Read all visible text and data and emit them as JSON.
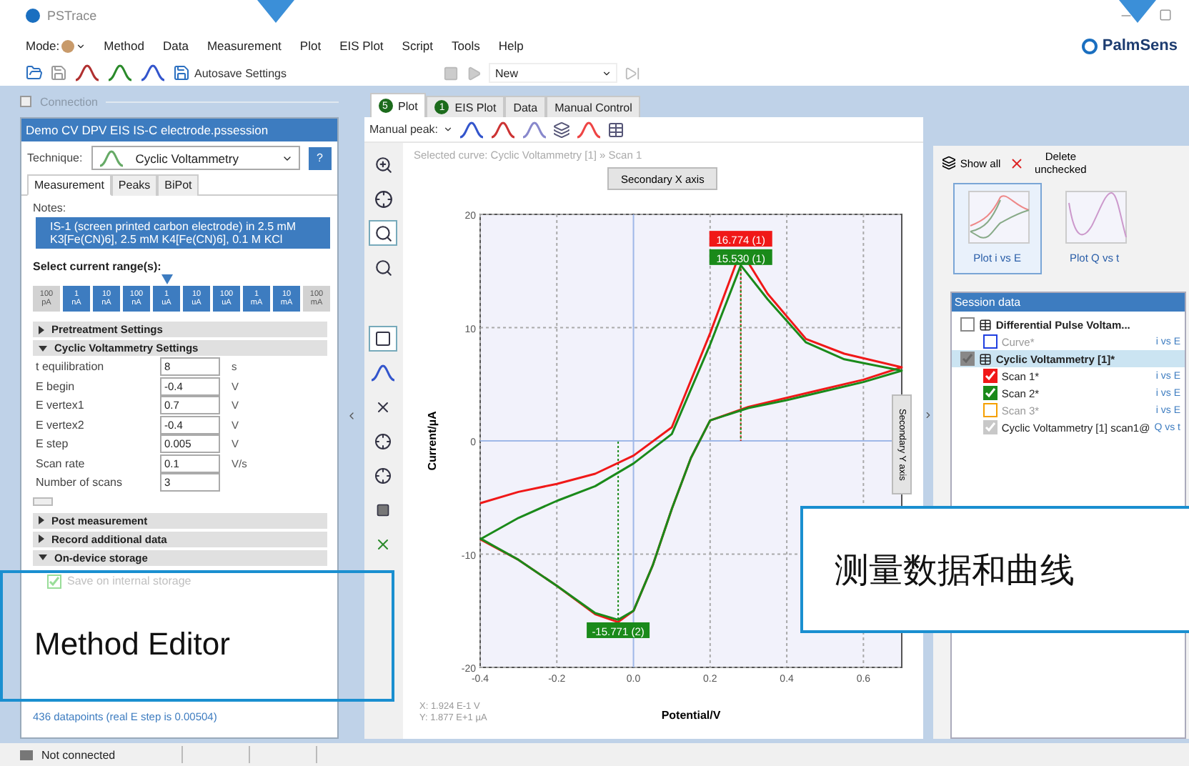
{
  "window": {
    "title": "PSTrace"
  },
  "menu": {
    "mode_label": "Mode:",
    "items": [
      "Method",
      "Data",
      "Measurement",
      "Plot",
      "EIS Plot",
      "Script",
      "Tools",
      "Help"
    ]
  },
  "brand": "PalmSens",
  "toolbar": {
    "autosave": "Autosave Settings",
    "script": "New"
  },
  "connection": {
    "title": "Connection",
    "expanded": false
  },
  "method_editor": {
    "file": "Demo CV DPV EIS IS-C electrode.pssession",
    "technique_label": "Technique:",
    "technique": "Cyclic Voltammetry",
    "help": "?",
    "tabs": [
      {
        "label": "Measurement",
        "selected": true
      },
      {
        "label": "Peaks",
        "selected": false
      },
      {
        "label": "BiPot",
        "selected": false
      }
    ],
    "notes_label": "Notes:",
    "notes": "IS-1 (screen printed carbon electrode) in 2.5 mM K3[Fe(CN)6], 2.5 mM K4[Fe(CN)6], 0.1 M KCl",
    "range_label": "Select current range(s):",
    "ranges": [
      {
        "value": "100",
        "unit": "pA",
        "enabled": false,
        "selected": false
      },
      {
        "value": "1",
        "unit": "nA",
        "enabled": true,
        "selected": false
      },
      {
        "value": "10",
        "unit": "nA",
        "enabled": true,
        "selected": false
      },
      {
        "value": "100",
        "unit": "nA",
        "enabled": true,
        "selected": false
      },
      {
        "value": "1",
        "unit": "uA",
        "enabled": true,
        "selected": true
      },
      {
        "value": "10",
        "unit": "uA",
        "enabled": true,
        "selected": false
      },
      {
        "value": "100",
        "unit": "uA",
        "enabled": true,
        "selected": false
      },
      {
        "value": "1",
        "unit": "mA",
        "enabled": true,
        "selected": false
      },
      {
        "value": "10",
        "unit": "mA",
        "enabled": true,
        "selected": false
      },
      {
        "value": "100",
        "unit": "mA",
        "enabled": false,
        "selected": false
      }
    ],
    "sections": [
      {
        "title": "Pretreatment Settings",
        "expanded": false
      },
      {
        "title": "Cyclic Voltammetry Settings",
        "expanded": true,
        "params": [
          {
            "label": "t equilibration",
            "value": "8",
            "unit": "s"
          },
          {
            "label": "E begin",
            "value": "-0.4",
            "unit": "V"
          },
          {
            "label": "E vertex1",
            "value": "0.7",
            "unit": "V"
          },
          {
            "label": "E vertex2",
            "value": "-0.4",
            "unit": "V"
          },
          {
            "label": "E step",
            "value": "0.005",
            "unit": "V"
          },
          {
            "label": "Scan rate",
            "value": "0.1",
            "unit": "V/s"
          },
          {
            "label": "Number of scans",
            "value": "3"
          }
        ]
      },
      {
        "title": "Post measurement",
        "expanded": false
      },
      {
        "title": "Record additional data",
        "expanded": false
      },
      {
        "title": "On-device storage",
        "expanded": true,
        "options": [
          {
            "label": "Save on internal storage",
            "checked": true,
            "disabled": true
          }
        ]
      }
    ],
    "datapoints": "436 datapoints (real E step is 0.00504)"
  },
  "plot_tabs": [
    {
      "label": "Plot",
      "badge": "5",
      "selected": true
    },
    {
      "label": "EIS Plot",
      "badge": "1",
      "selected": false
    },
    {
      "label": "Data",
      "selected": false
    },
    {
      "label": "Manual Control",
      "selected": false
    }
  ],
  "plot_toolbar": {
    "manual_peak": "Manual peak:"
  },
  "plot": {
    "selected_curve": "Selected curve: Cyclic Voltammetry [1] » Scan 1",
    "secondary_x": "Secondary X axis",
    "secondary_y": "Secondary Y axis",
    "cursor_x": "X: 1.924 E-1 V",
    "cursor_y": "Y: 1.877 E+1 µA",
    "chart_data": {
      "type": "line",
      "xlabel": "Potential/V",
      "ylabel": "Current/µA",
      "xlim": [
        -0.4,
        0.7
      ],
      "ylim": [
        -20,
        20
      ],
      "xticks": [
        -0.4,
        -0.2,
        {
          "value": 0,
          "label": "0.0"
        },
        0.2,
        0.4,
        0.6
      ],
      "yticks": [
        -20,
        -10,
        0,
        10,
        20
      ],
      "grid": true,
      "x": [
        -0.4,
        -0.3,
        -0.2,
        -0.1,
        0,
        0.1,
        0.2,
        0.28,
        0.35,
        0.45,
        0.55,
        0.7,
        0.6,
        0.5,
        0.4,
        0.3,
        0.2,
        0.15,
        0.1,
        0.05,
        0,
        -0.04,
        -0.1,
        -0.2,
        -0.3,
        -0.4
      ],
      "series": [
        {
          "color": "#f01818",
          "values": [
            -5.5,
            -4.5,
            -3.8,
            -2.9,
            -1.3,
            1.2,
            9.5,
            16.8,
            13,
            9,
            7.7,
            6.5,
            5.4,
            4.6,
            3.8,
            3,
            1.8,
            -1.5,
            -6,
            -11,
            -15,
            -16,
            -15.3,
            -12.8,
            -10.5,
            -8.7
          ]
        },
        {
          "color": "#1a8a1a",
          "values": [
            -8.7,
            -6.8,
            -5.3,
            -4,
            -2,
            0.6,
            8.5,
            15.5,
            12.5,
            8.7,
            7.2,
            6.2,
            5.2,
            4.4,
            3.6,
            2.9,
            1.8,
            -1.5,
            -6,
            -11,
            -15,
            -15.8,
            -15.2,
            -12.8,
            -10.5,
            -8.6
          ]
        }
      ],
      "annotations": [
        {
          "text": "16.774 (1)",
          "y": 16.774
        },
        {
          "text": "15.530 (1)",
          "y": 15.53
        },
        {
          "text": "-15.771 (2)",
          "y": -15.771
        }
      ]
    }
  },
  "session": {
    "show_all": "Show all",
    "delete": "Delete unchecked",
    "thumbnails": [
      {
        "label": "Plot i vs E",
        "selected": true
      },
      {
        "label": "Plot Q vs t",
        "selected": false
      }
    ],
    "title": "Session data",
    "tree": [
      {
        "label": "Differential Pulse Voltam...",
        "checked": false,
        "selected": false,
        "disabled": false,
        "children": [
          {
            "label": "Curve*",
            "checked": false,
            "selected": false,
            "disabled": true,
            "color": "#1f3fe0",
            "axis": "i vs E"
          }
        ]
      },
      {
        "label": "Cyclic Voltammetry [1]*",
        "checked": true,
        "selected": true,
        "disabled": false,
        "children": [
          {
            "label": "Scan 1*",
            "checked": true,
            "selected": false,
            "disabled": false,
            "color": "#f01818",
            "axis": "i vs E"
          },
          {
            "label": "Scan 2*",
            "checked": true,
            "selected": false,
            "disabled": false,
            "color": "#1a8a1a",
            "axis": "i vs E"
          },
          {
            "label": "Scan 3*",
            "checked": false,
            "selected": false,
            "disabled": true,
            "color": "#f5a000",
            "axis": "i vs E"
          },
          {
            "label": "Cyclic Voltammetry [1] scan1@",
            "checked": true,
            "selected": false,
            "disabled": false,
            "color": "#c8c8c8",
            "axis": "Q vs t"
          }
        ]
      }
    ]
  },
  "status": "Not connected",
  "callouts": [
    {
      "text": "Method Editor"
    },
    {
      "text": "测量数据和曲线"
    }
  ]
}
